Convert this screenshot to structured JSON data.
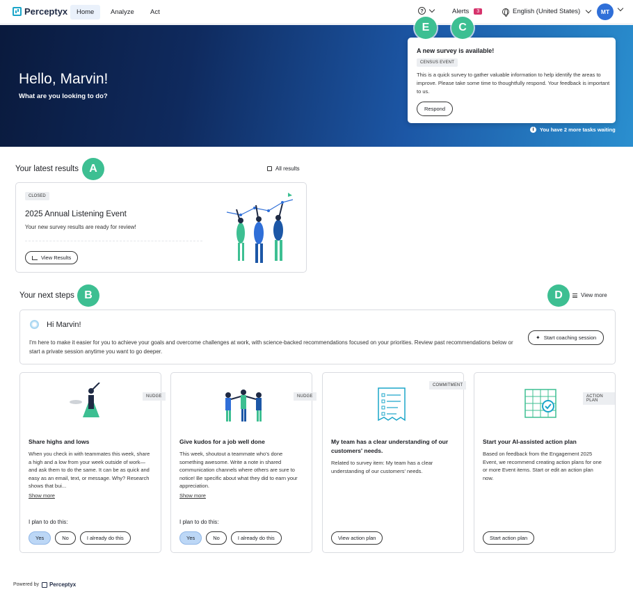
{
  "app": {
    "logo_text": "Perceptyx"
  },
  "nav": {
    "tabs": [
      "Home",
      "Analyze",
      "Act"
    ],
    "alerts_label": "Alerts",
    "alerts_count": "3",
    "language": "English (United States)",
    "avatar_initials": "MT"
  },
  "hero": {
    "greeting": "Hello, Marvin!",
    "subtitle": "What are you looking to do?",
    "survey": {
      "title": "A new survey is available!",
      "badge": "CENSUS EVENT",
      "body": "This is a quick survey to gather valuable information to help identify the areas to improve. Please take some time to thoughtfully respond. Your feedback is important to us.",
      "button": "Respond"
    },
    "tasks_waiting": "You have 2 more tasks waiting"
  },
  "markers": {
    "a": "A",
    "b": "B",
    "c": "C",
    "d": "D",
    "e": "E"
  },
  "latest_results": {
    "section_title": "Your latest results",
    "all_results": "All results",
    "card": {
      "badge": "CLOSED",
      "title": "2025 Annual Listening Event",
      "subtitle": "Your new survey results are ready for review!",
      "button": "View Results"
    }
  },
  "next_steps": {
    "section_title": "Your next steps",
    "view_more": "View more",
    "coach": {
      "title": "Hi Marvin!",
      "body": "I'm here to make it easier for you to achieve your goals and overcome challenges at work, with science-backed recommendations focused on your priorities. Review past recommendations below or start a private session anytime you want to go deeper.",
      "button": "Start coaching session"
    },
    "cards": [
      {
        "badge": "NUDGE",
        "title": "Share highs and lows",
        "desc": "When you check in with teammates this week, share a high and a low from your week outside of work—and ask them to do the same. It can be as quick and easy as an email, text, or message. Why? Research shows that bui...",
        "show_more": "Show more",
        "plan_label": "I plan to do this:",
        "choices": [
          "Yes",
          "No",
          "I already do this"
        ]
      },
      {
        "badge": "NUDGE",
        "title": "Give kudos for a job well done",
        "desc": "This week, shoutout a teammate who's done something awesome. Write a note in shared communication channels where others are sure to notice! Be specific about what they did to earn your appreciation.",
        "show_more": "Show more",
        "plan_label": "I plan to do this:",
        "choices": [
          "Yes",
          "No",
          "I already do this"
        ]
      },
      {
        "badge": "COMMITMENT",
        "title": "My team has a clear understanding of our customers' needs.",
        "desc": "Related to survey item: My team has a clear understanding of our customers' needs.",
        "button": "View action plan"
      },
      {
        "badge": "ACTION PLAN",
        "title": "Start your AI-assisted action plan",
        "desc": "Based on feedback from the Engagement 2025 Event, we recommend creating action plans for one or more Event items. Start or edit an action plan now.",
        "button": "Start action plan"
      }
    ]
  },
  "footer": {
    "powered_by": "Powered by",
    "logo_text": "Perceptyx"
  },
  "colors": {
    "accent": "#3dbf92",
    "brand": "#1aa5c9",
    "avatar": "#2f6fd8",
    "alert": "#d6336c",
    "selected": "#bcd7f6"
  }
}
